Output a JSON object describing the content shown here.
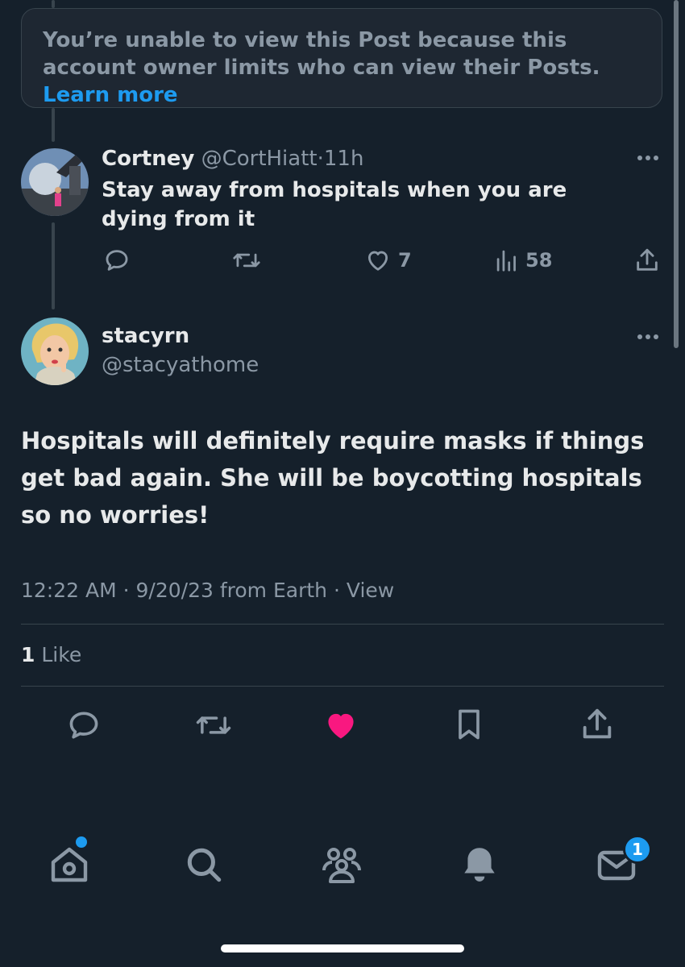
{
  "notice": {
    "text": "You’re unable to view this Post because this account owner limits who can view their Posts.",
    "link": "Learn more"
  },
  "reply": {
    "name": "Cortney",
    "handle": "@CortHiatt",
    "separator": "·",
    "time": "11h",
    "text": "Stay away from hospitals when you are dying from it",
    "likes": "7",
    "views": "58",
    "icons": [
      "reply-icon",
      "retweet-icon",
      "heart-outline-icon",
      "views-icon",
      "share-icon",
      "more-icon"
    ]
  },
  "main": {
    "name": "stacyrn",
    "handle": "@stacyathome",
    "text": "Hospitals will definitely require masks if things get bad again. She will be boycotting hospitals so no worries!",
    "time": "12:22 AM",
    "separator": "·",
    "date": "9/20/23",
    "source": "from Earth",
    "view": "View",
    "like_count": "1",
    "like_label": "Like",
    "liked": true,
    "icons": [
      "reply-icon",
      "retweet-icon",
      "heart-filled-icon",
      "bookmark-icon",
      "share-icon",
      "more-icon"
    ]
  },
  "tabbar": {
    "items": [
      "home-icon",
      "search-icon",
      "communities-icon",
      "notifications-icon",
      "messages-icon"
    ],
    "messages_badge": "1"
  },
  "colors": {
    "background": "#15202b",
    "accent": "#1d9bf0",
    "like": "#f91880",
    "muted": "#8b98a5",
    "border": "#38444d"
  }
}
